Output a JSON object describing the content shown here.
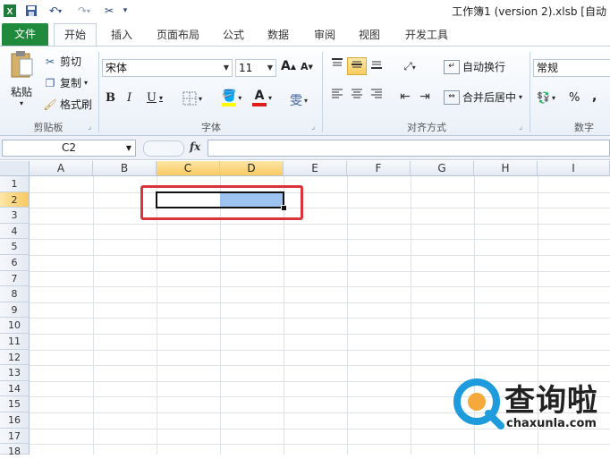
{
  "window": {
    "title": "工作簿1 (version 2).xlsb [自动"
  },
  "tabs": [
    {
      "label": "文件"
    },
    {
      "label": "开始"
    },
    {
      "label": "插入"
    },
    {
      "label": "页面布局"
    },
    {
      "label": "公式"
    },
    {
      "label": "数据"
    },
    {
      "label": "审阅"
    },
    {
      "label": "视图"
    },
    {
      "label": "开发工具"
    }
  ],
  "ribbon": {
    "clipboard": {
      "paste": "粘贴",
      "cut": "剪切",
      "copy": "复制",
      "format_painter": "格式刷",
      "group_label": "剪贴板"
    },
    "font": {
      "font_name": "宋体",
      "font_size": "11",
      "bold": "B",
      "italic": "I",
      "underline": "U",
      "grow": "A",
      "shrink": "A",
      "font_color_glyph": "A",
      "wen": "雯",
      "group_label": "字体"
    },
    "alignment": {
      "wrap_text": "自动换行",
      "merge_center": "合并后居中",
      "group_label": "对齐方式"
    },
    "number": {
      "format": "常规",
      "percent": "%",
      "comma": ",",
      "group_label": "数字"
    }
  },
  "formula_bar": {
    "name_box": "C2",
    "fx": "fx",
    "value": ""
  },
  "sheet": {
    "columns": [
      "A",
      "B",
      "C",
      "D",
      "E",
      "F",
      "G",
      "H",
      "I"
    ],
    "rows": [
      "1",
      "2",
      "3",
      "4",
      "5",
      "6",
      "7",
      "8",
      "9",
      "10",
      "11",
      "12",
      "13",
      "14",
      "15",
      "16",
      "17",
      "18"
    ],
    "selection": "C2:D2",
    "active_cell": "C2"
  },
  "watermark": {
    "brand": "查询啦",
    "domain": "chaxunla.com"
  },
  "colors": {
    "file_tab": "#1f8a3c",
    "selection_highlight": "#9dc3f0",
    "annotation_box": "#d9343a",
    "header_selected": "#f8c960"
  }
}
